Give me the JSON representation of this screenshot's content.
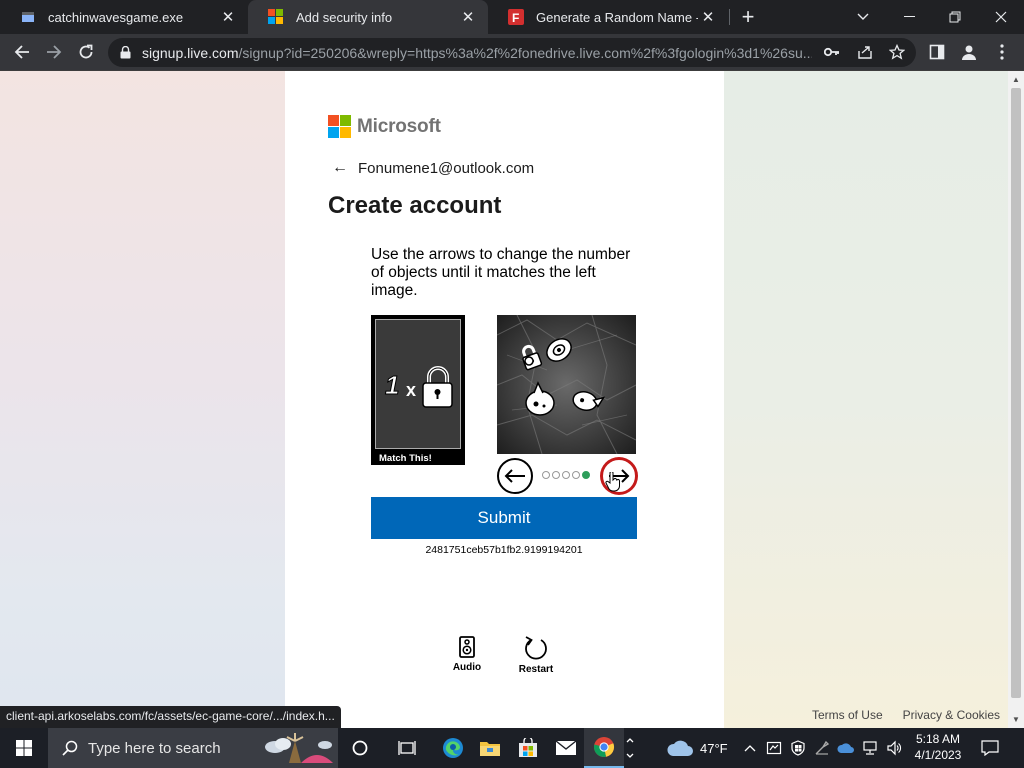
{
  "browser": {
    "tabs": [
      {
        "title": "catchinwavesgame.exe",
        "favicon": "file-icon"
      },
      {
        "title": "Add security info",
        "favicon": "microsoft-logo"
      },
      {
        "title": "Generate a Random Name - Fake",
        "favicon": "fakename-f-icon"
      }
    ],
    "active_tab": 1,
    "url_host": "signup.live.com",
    "url_rest": "/signup?id=250206&wreply=https%3a%2f%2fonedrive.live.com%2f%3fgologin%3d1%26su..."
  },
  "page": {
    "brand": "Microsoft",
    "identity": "Fonumene1@outlook.com",
    "title": "Create account",
    "puzzle": {
      "instructions": "Use the arrows to change the number of objects until it matches the left image.",
      "match_count": "1",
      "match_multiplier": "x",
      "match_label": "Match This!",
      "dots_total": 5,
      "dot_active": 5,
      "submit_label": "Submit",
      "session_id": "2481751ceb57b1fb2.9199194201",
      "audio_label": "Audio",
      "restart_label": "Restart"
    },
    "footer": {
      "terms": "Terms of Use",
      "privacy": "Privacy & Cookies"
    },
    "status_url": "client-api.arkoselabs.com/fc/assets/ec-game-core/.../index.h..."
  },
  "taskbar": {
    "search_placeholder": "Type here to search",
    "weather": "47°F",
    "time": "5:18 AM",
    "date": "4/1/2023"
  },
  "colors": {
    "accent": "#0067b8",
    "ms_red": "#f25022",
    "ms_green": "#7fba00",
    "ms_blue": "#00a4ef",
    "ms_yellow": "#ffb900",
    "dot_active": "#2e9e5b",
    "next_border": "#c41a1a"
  }
}
